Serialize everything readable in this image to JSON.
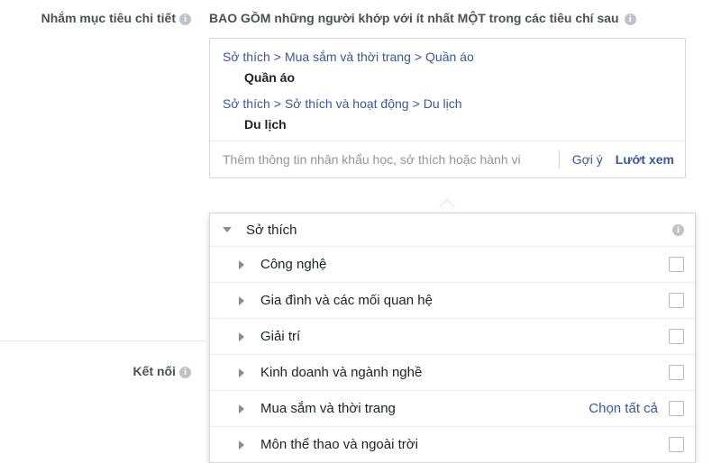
{
  "left": {
    "rows": [
      {
        "label": "Nhắm mục tiêu chi tiết",
        "info": "i"
      },
      {
        "label": "Kết nối",
        "info": "i"
      }
    ]
  },
  "panel": {
    "title": "BAO GỒM những người khớp với ít nhất MỘT trong các tiêu chí sau",
    "title_info": "i"
  },
  "selections": [
    {
      "crumb": [
        "Sở thích",
        "Mua sắm và thời trang",
        "Quần áo"
      ],
      "value": "Quần áo"
    },
    {
      "crumb": [
        "Sở thích",
        "Sở thích và hoạt động",
        "Du lịch"
      ],
      "value": "Du lịch"
    }
  ],
  "search": {
    "placeholder": "Thêm thông tin nhân khẩu học, sở thích hoặc hành vi",
    "value": "",
    "suggest_label": "Gợi ý",
    "browse_label": "Lướt xem"
  },
  "dropdown": {
    "header": {
      "title": "Sở thích",
      "caret": "chevron-down-icon",
      "info": "i"
    },
    "items": [
      {
        "label": "Công nghệ",
        "select_all": "",
        "checked": false
      },
      {
        "label": "Gia đình và các mối quan hệ",
        "select_all": "",
        "checked": false
      },
      {
        "label": "Giải trí",
        "select_all": "",
        "checked": false
      },
      {
        "label": "Kinh doanh và ngành nghề",
        "select_all": "",
        "checked": false
      },
      {
        "label": "Mua sắm và thời trang",
        "select_all": "Chọn tất cả",
        "checked": false
      },
      {
        "label": "Môn thể thao và ngoài trời",
        "select_all": "",
        "checked": false
      }
    ]
  },
  "colors": {
    "link": "#365899",
    "text": "#1d2129",
    "muted": "#90949c",
    "border": "#d3d6db",
    "info_icon": "#bec3c9"
  }
}
